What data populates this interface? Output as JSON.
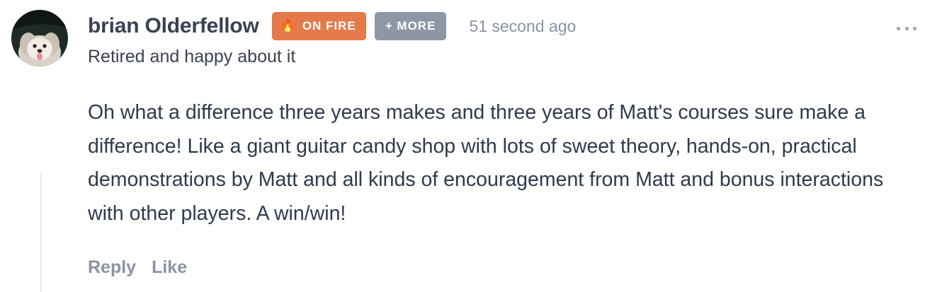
{
  "comment": {
    "author": {
      "name": "brian Olderfellow",
      "tagline": "Retired and happy about it",
      "avatar_icon": "dog-photo-avatar"
    },
    "badges": {
      "fire": {
        "icon": "🔥",
        "label": "ON FIRE",
        "color": "#e4794a"
      },
      "more": {
        "label": "+ MORE",
        "color": "#8d97a6"
      }
    },
    "timestamp": "51 second ago",
    "options_icon": "more-horizontal-icon",
    "body": "Oh what a difference three years makes and three years of Matt's courses sure make a difference! Like a giant guitar candy shop with lots of sweet theory, hands-on, practical demonstrations by Matt and all kinds of encouragement from Matt and bonus interactions with other players. A win/win!",
    "actions": {
      "reply": "Reply",
      "like": "Like"
    }
  }
}
